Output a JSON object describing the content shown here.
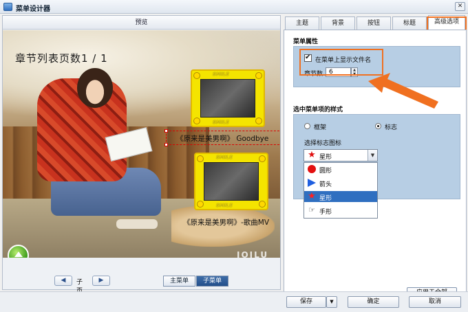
{
  "window": {
    "title": "菜单设计器",
    "close_glyph": "✕"
  },
  "preview": {
    "header": "预览",
    "page_title": "章节列表页数1 / 1",
    "thumb_caption": "SMILE",
    "chapters": [
      "《原来是美男啊》 Goodbye",
      "《原来是美男啊》-歌曲MV"
    ],
    "watermark": "IOILU",
    "pager": {
      "prev": "◀",
      "label": "子页",
      "next": "▶"
    },
    "modes": {
      "main": "主菜单",
      "sub": "子菜单"
    }
  },
  "tabs": [
    "主题",
    "背景",
    "按钮",
    "标题",
    "高级选项"
  ],
  "active_tab": 4,
  "menu_props": {
    "title": "菜单属性",
    "show_filename_label": "在菜单上显示文件名",
    "show_filename_checked": true,
    "chapter_count_label": "章节数",
    "chapter_count_value": "6"
  },
  "item_style": {
    "title": "选中菜单项的样式",
    "options": [
      "框架",
      "标志"
    ],
    "selected_option": 1,
    "icon_select_label": "选择标志图标",
    "selected_icon": "星形",
    "icon_list": [
      {
        "label": "圆形",
        "icon": "circle-icon"
      },
      {
        "label": "箭头",
        "icon": "arrow-icon"
      },
      {
        "label": "星形",
        "icon": "star-icon"
      },
      {
        "label": "手形",
        "icon": "hand-icon"
      }
    ],
    "selected_index": 2,
    "apply_all": "应用于全部"
  },
  "footer": {
    "save": "保存",
    "ok": "确定",
    "cancel": "取消"
  },
  "colors": {
    "accent": "#2f6fc0",
    "highlight": "#f07020",
    "group_bg": "#b7cee4"
  }
}
